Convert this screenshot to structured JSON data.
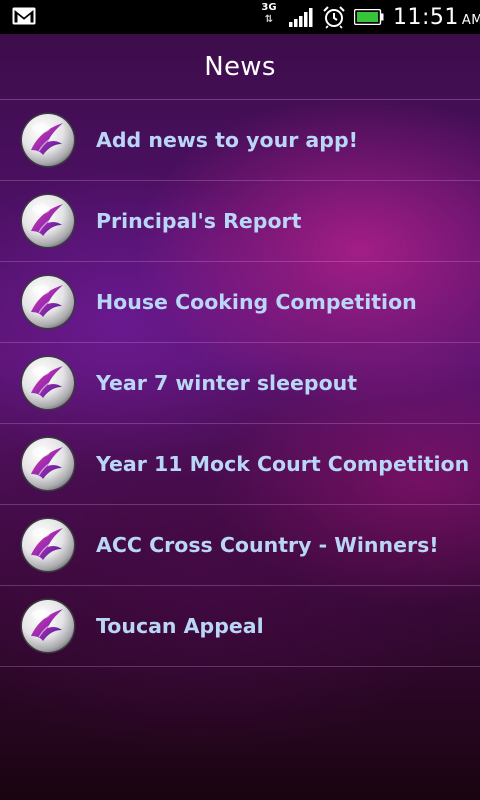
{
  "status_bar": {
    "network_type": "3G",
    "network_arrows": "⇅",
    "time": "11:51",
    "ampm": "AM",
    "icons": [
      "gmail-icon",
      "network-3g-icon",
      "signal-icon",
      "alarm-icon",
      "battery-icon"
    ],
    "battery_color": "#35c43a"
  },
  "header": {
    "title": "News"
  },
  "news": {
    "items": [
      {
        "label": "Add news to your app!",
        "icon": "app-logo-icon"
      },
      {
        "label": "Principal's Report",
        "icon": "app-logo-icon"
      },
      {
        "label": "House Cooking Competition",
        "icon": "app-logo-icon"
      },
      {
        "label": "Year 7 winter sleepout",
        "icon": "app-logo-icon"
      },
      {
        "label": "Year 11 Mock Court Competition",
        "icon": "app-logo-icon"
      },
      {
        "label": "ACC Cross Country - Winners!",
        "icon": "app-logo-icon"
      },
      {
        "label": "Toucan Appeal",
        "icon": "app-logo-icon"
      }
    ]
  },
  "colors": {
    "item_text": "#b9d6f6",
    "title_text": "#ffffff",
    "background_accent": "#c21b8c"
  }
}
